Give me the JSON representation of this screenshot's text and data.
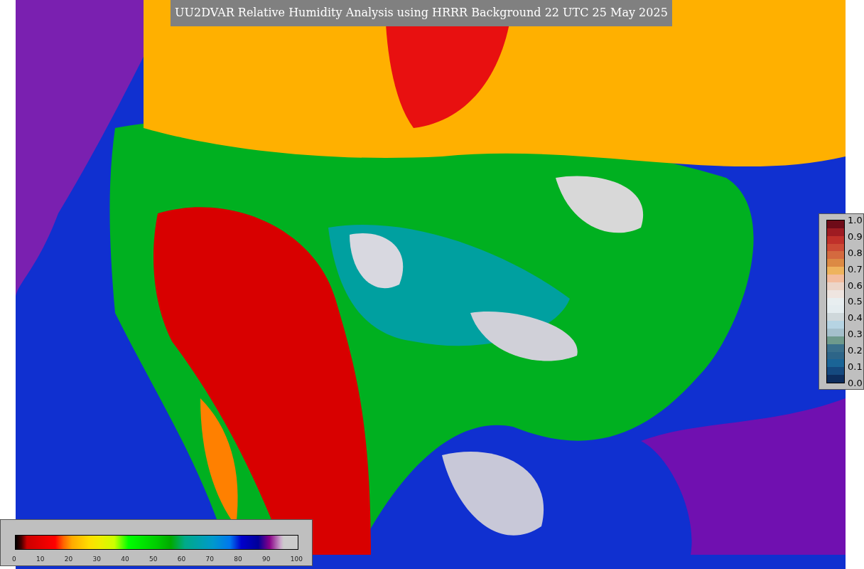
{
  "title": "UU2DVAR Relative Humidity Analysis using HRRR Background 22 UTC 25 May 2025",
  "ratio_legend": {
    "ticks": [
      "1.0",
      "0.9",
      "0.8",
      "0.7",
      "0.6",
      "0.5",
      "0.4",
      "0.3",
      "0.2",
      "0.1",
      "0.0"
    ]
  },
  "humidity_legend": {
    "ticks": [
      "0",
      "10",
      "20",
      "30",
      "40",
      "50",
      "60",
      "70",
      "80",
      "90",
      "100"
    ]
  }
}
